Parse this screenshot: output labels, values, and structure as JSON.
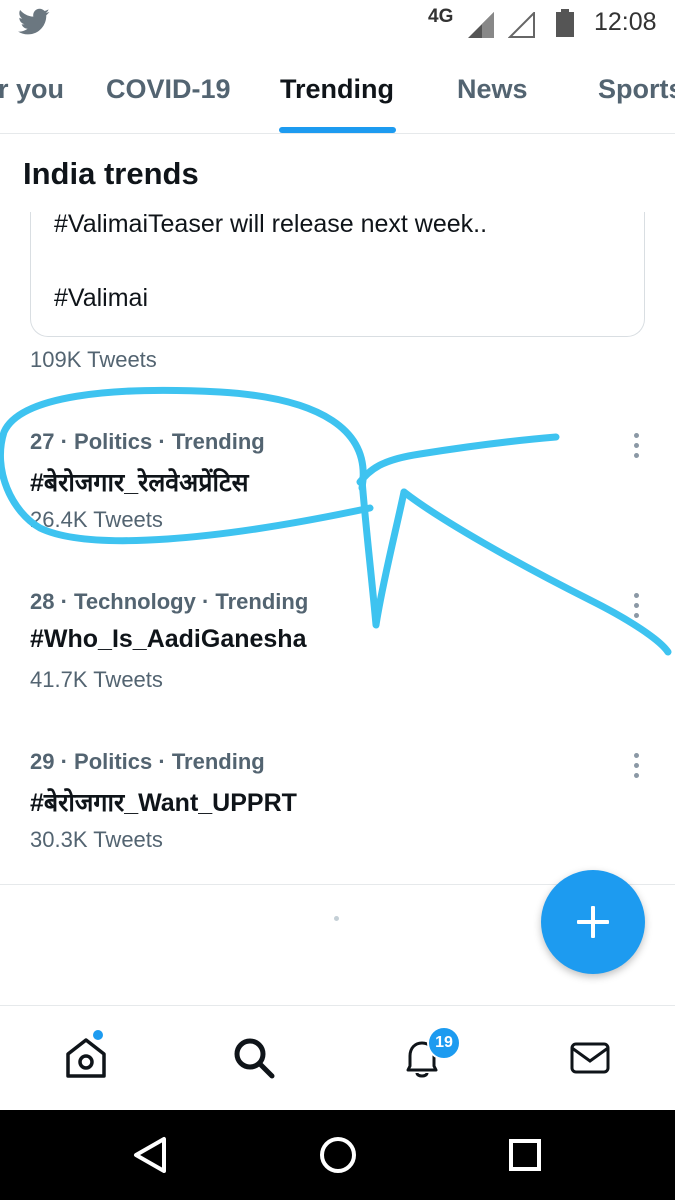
{
  "status_bar": {
    "app_icon": "twitter-bird-icon",
    "network": "4G",
    "time": "12:08"
  },
  "tabs": [
    {
      "label": "r you",
      "active": false
    },
    {
      "label": "COVID-19",
      "active": false
    },
    {
      "label": "Trending",
      "active": true
    },
    {
      "label": "News",
      "active": false
    },
    {
      "label": "Sports",
      "active": false
    }
  ],
  "section_title": "India trends",
  "embedded_card": {
    "line1": "#ValimaiTeaser will release next week..",
    "line2": "#Valimai",
    "tweet_count": "109K Tweets"
  },
  "trends": [
    {
      "meta": "27 · Politics · Trending",
      "name": "#बेरोजगार_रेलवेअप्रेंटिस",
      "count": "26.4K Tweets"
    },
    {
      "meta": "28 · Technology · Trending",
      "name": "#Who_Is_AadiGanesha",
      "count": "41.7K Tweets"
    },
    {
      "meta": "29 · Politics · Trending",
      "name": "#बेरोजगार_Want_UPPRT",
      "count": "30.3K Tweets"
    }
  ],
  "fab_icon": "plus-icon",
  "bottom_nav": {
    "items": [
      "home-icon",
      "search-icon",
      "notifications-icon",
      "messages-icon"
    ],
    "notification_badge": "19"
  },
  "android_nav": [
    "back-icon",
    "home-circle-icon",
    "recents-icon"
  ],
  "colors": {
    "accent": "#1d9bf0",
    "annotation": "#3ec3f0",
    "secondary_text": "#536471"
  }
}
